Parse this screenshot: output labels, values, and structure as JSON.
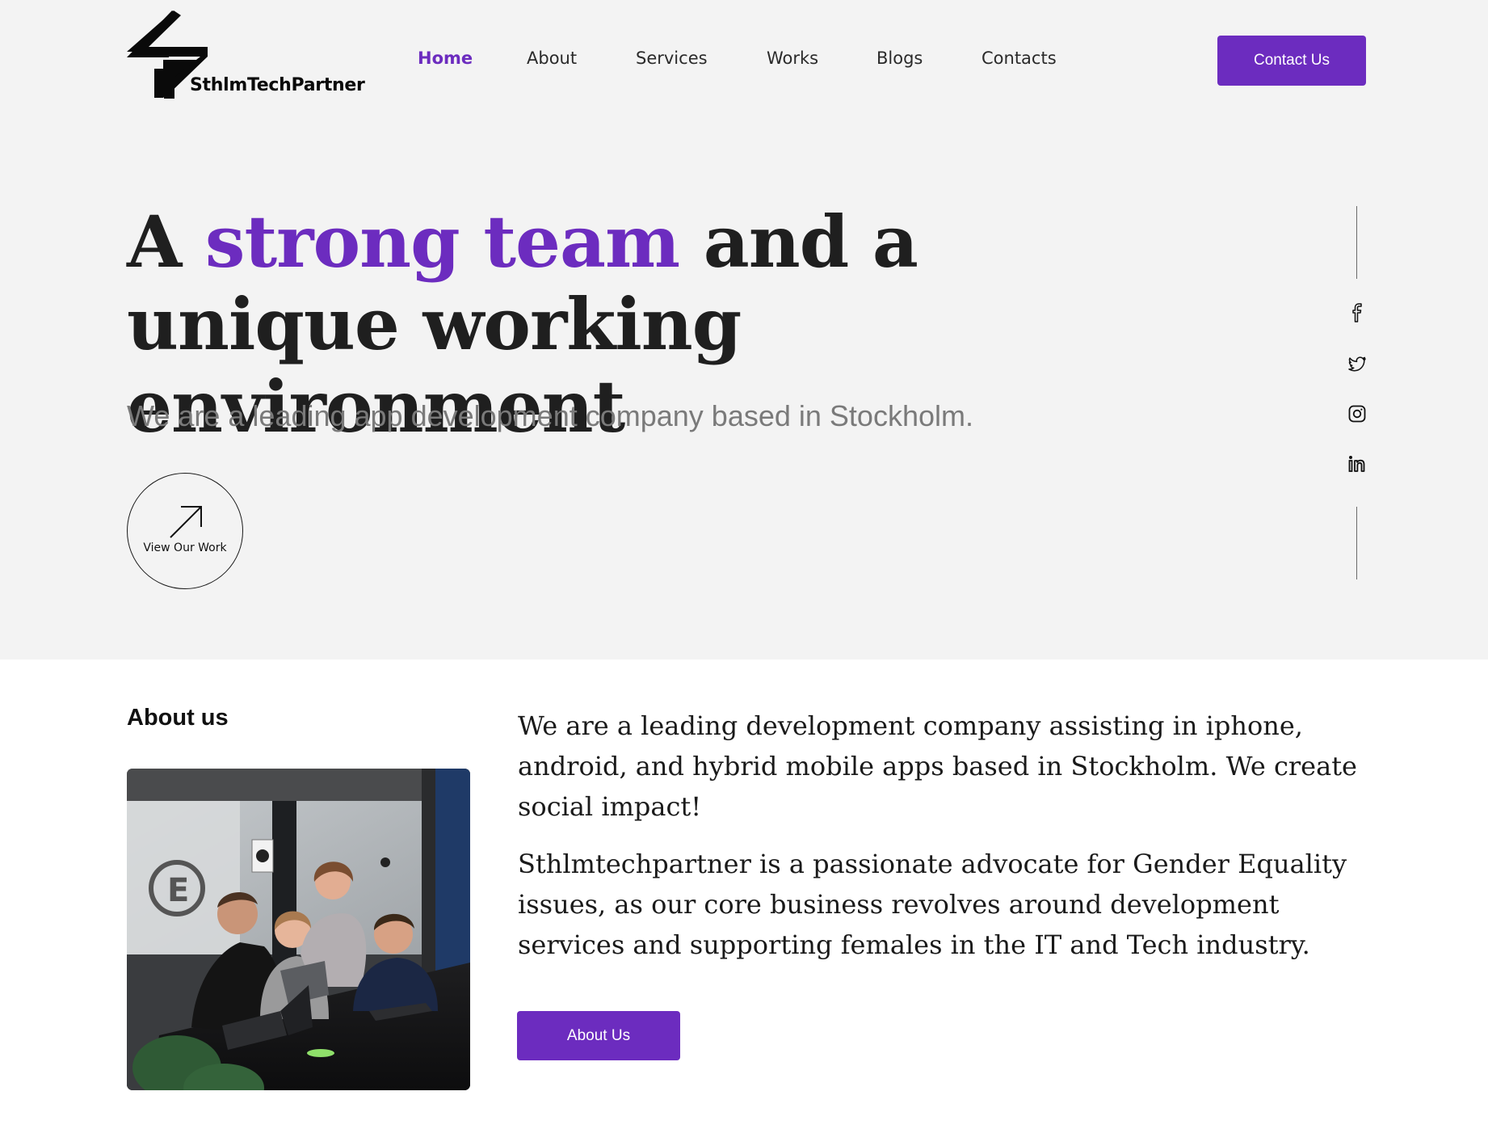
{
  "brand": {
    "name": "SthlmTechPartner"
  },
  "nav": {
    "items": [
      {
        "label": "Home",
        "active": true
      },
      {
        "label": "About"
      },
      {
        "label": "Services"
      },
      {
        "label": "Works"
      },
      {
        "label": "Blogs"
      },
      {
        "label": "Contacts"
      }
    ],
    "cta_label": "Contact Us"
  },
  "hero": {
    "headline_before": "A ",
    "headline_accent": "strong team",
    "headline_after": " and a unique working environment",
    "subtitle": "We are a leading app development company based in Stockholm.",
    "view_work_label": "View Our Work"
  },
  "social": {
    "icons": [
      "facebook-icon",
      "twitter-icon",
      "instagram-icon",
      "linkedin-icon"
    ]
  },
  "about": {
    "heading": "About us",
    "paragraph1": "We are a leading development company assisting in iphone, android, and hybrid mobile apps based in Stockholm. We create social impact!",
    "paragraph2": "Sthlmtechpartner is a passionate advocate for Gender Equality issues, as our core business revolves around development services and supporting females in the IT and Tech industry.",
    "button_label": "About Us"
  },
  "colors": {
    "accent": "#6c2cbf",
    "hero_bg": "#f3f3f3",
    "text": "#1f1f1f",
    "muted": "#7a7a7a"
  }
}
